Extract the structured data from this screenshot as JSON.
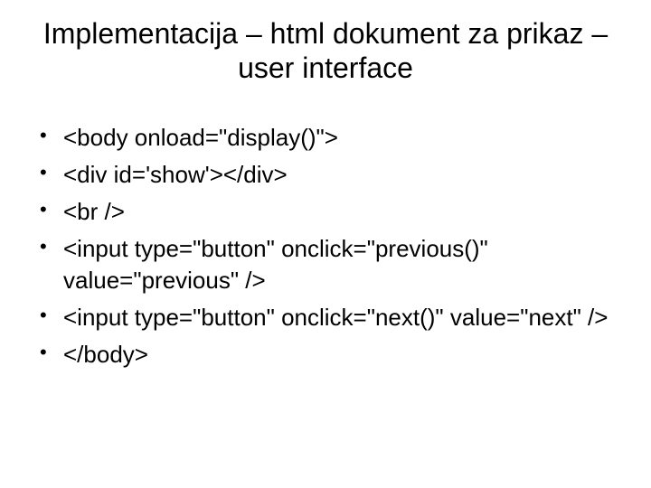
{
  "slide": {
    "title": "Implementacija – html dokument za prikaz – user interface",
    "bullets": [
      "<body onload=\"display()\">",
      "<div id='show'></div>",
      "<br />",
      "<input type=\"button\" onclick=\"previous()\" value=\"previous\" />",
      "<input type=\"button\" onclick=\"next()\" value=\"next\" />",
      "</body>"
    ]
  }
}
